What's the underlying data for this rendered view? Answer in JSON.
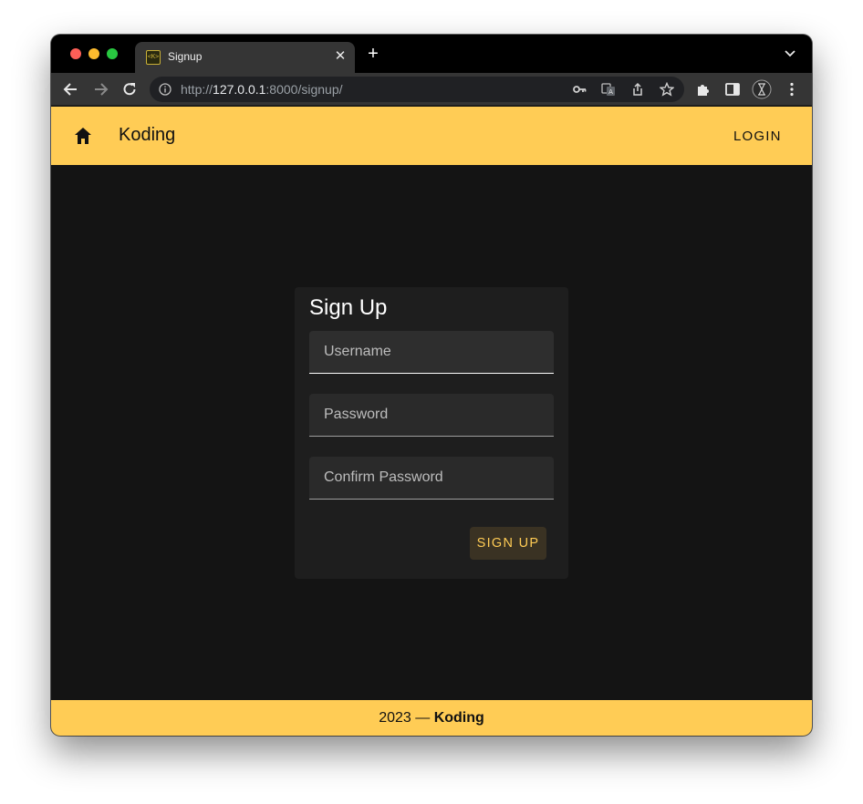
{
  "browser": {
    "tab_title": "Signup",
    "favicon_text": "<K>",
    "url_scheme": "http://",
    "url_host": "127.0.0.1",
    "url_rest": ":8000/signup/"
  },
  "appbar": {
    "brand": "Koding",
    "login_label": "LOGIN"
  },
  "form": {
    "title": "Sign Up",
    "username_label": "Username",
    "password_label": "Password",
    "confirm_label": "Confirm Password",
    "submit_label": "SIGN UP"
  },
  "footer": {
    "year_text": "2023 — ",
    "brand": "Koding"
  },
  "colors": {
    "accent": "#ffcc55",
    "background": "#141414",
    "card": "#1e1e1e"
  }
}
